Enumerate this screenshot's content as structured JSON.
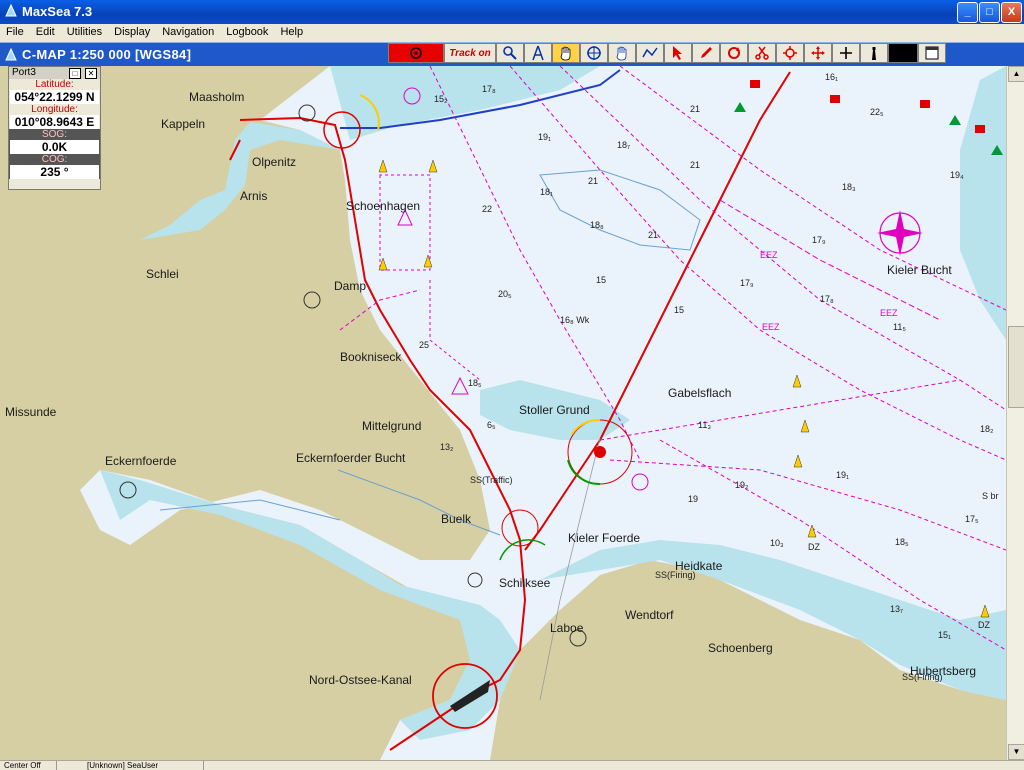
{
  "app": {
    "title": "MaxSea 7.3",
    "min_label": "_",
    "max_label": "□",
    "close_label": "X"
  },
  "menu": [
    "File",
    "Edit",
    "Utilities",
    "Display",
    "Navigation",
    "Logbook",
    "Help"
  ],
  "chart": {
    "title": "C-MAP  1:250 000 [WGS84]"
  },
  "toolbar": {
    "track_label": "Track on",
    "tools": [
      "record-icon",
      "track-on",
      "zoom-icon",
      "compass-icon",
      "hand-pan-icon",
      "crosshair-icon",
      "hand-icon",
      "route-icon",
      "cursor-icon",
      "pencil-icon",
      "rotate-icon",
      "scissors-icon",
      "target-icon",
      "move-icon",
      "plus-icon",
      "lighthouse-icon",
      "black-square",
      "window-icon"
    ]
  },
  "panel": {
    "title": "Port3",
    "lat_label": "Latitude:",
    "lat_value": "054°22.1299 N",
    "lon_label": "Longitude:",
    "lon_value": "010°08.9643 E",
    "sog_label": "SOG:",
    "sog_value": "0.0K",
    "cog_label": "COG:",
    "cog_value": "235 °"
  },
  "places": [
    "Maasholm",
    "Kappeln",
    "Olpenitz",
    "Arnis",
    "Schoenhagen",
    "Schlei",
    "Damp",
    "Bookniseck",
    "Missunde",
    "Mittelgrund",
    "Eckernfoerde",
    "Eckernfoerder Bucht",
    "Stoller Grund",
    "Gabelsflach",
    "Kieler Bucht",
    "Buelk",
    "Kieler Foerde",
    "Heidkate",
    "Schilksee",
    "Wendtorf",
    "Laboe",
    "Schoenberg",
    "Nord-Ostsee-Kanal",
    "Hubertsberg"
  ],
  "labels": {
    "traffic": "SS(Traffic)",
    "firing": "SS(Firing)",
    "eez": "EEZ",
    "wk": "Wk",
    "dz": "DZ",
    "sbr": "S br"
  },
  "status": {
    "cell1": "Center Off",
    "cell2": "[Unknown] SeaUser"
  }
}
